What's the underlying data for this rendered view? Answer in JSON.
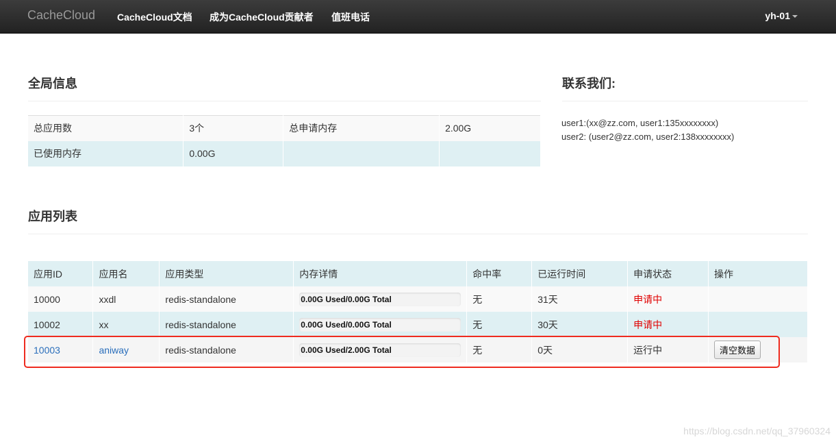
{
  "navbar": {
    "brand": "CacheCloud",
    "links": [
      {
        "label": "CacheCloud文档"
      },
      {
        "label": "成为CacheCloud贡献者"
      },
      {
        "label": "值班电话"
      }
    ],
    "user": "yh-01"
  },
  "global_info": {
    "title": "全局信息",
    "rows": [
      [
        "总应用数",
        "3个",
        "总申请内存",
        "2.00G"
      ],
      [
        "已使用内存",
        "0.00G",
        "",
        ""
      ]
    ]
  },
  "contact": {
    "title": "联系我们:",
    "lines": [
      "user1:(xx@zz.com, user1:135xxxxxxxx)",
      "user2: (user2@zz.com, user2:138xxxxxxxx)"
    ]
  },
  "app_list": {
    "title": "应用列表",
    "headers": [
      "应用ID",
      "应用名",
      "应用类型",
      "内存详情",
      "命中率",
      "已运行时间",
      "申请状态",
      "操作"
    ],
    "rows": [
      {
        "id": "10000",
        "name": "xxdl",
        "type": "redis-standalone",
        "memory": "0.00G  Used/0.00G  Total",
        "memory_used_fraction": 0,
        "hit_rate": "无",
        "uptime": "31天",
        "status": "申请中",
        "action": ""
      },
      {
        "id": "10002",
        "name": "xx",
        "type": "redis-standalone",
        "memory": "0.00G  Used/0.00G  Total",
        "memory_used_fraction": 0,
        "hit_rate": "无",
        "uptime": "30天",
        "status": "申请中",
        "action": ""
      },
      {
        "id": "10003",
        "name": "aniway",
        "type": "redis-standalone",
        "memory": "0.00G  Used/2.00G  Total",
        "memory_used_fraction": 0,
        "hit_rate": "无",
        "uptime": "0天",
        "status": "运行中",
        "action": "清空数据"
      }
    ]
  },
  "watermark": "https://blog.csdn.net/qq_37960324",
  "colors": {
    "pending_status": "#e00000",
    "link": "#2a6ebb",
    "highlight_box": "#ee2b1f",
    "table_stripe": "#dff0f3"
  }
}
